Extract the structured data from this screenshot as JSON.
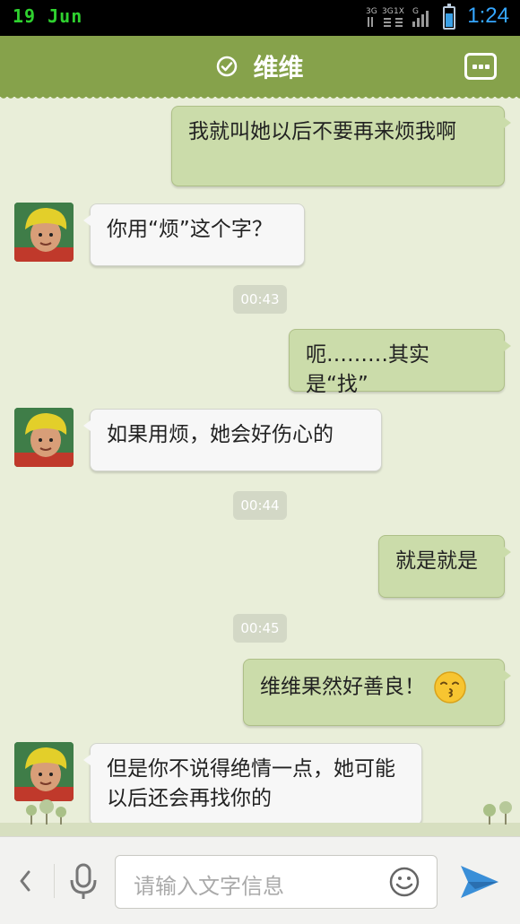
{
  "status_bar": {
    "date": "19 Jun",
    "network_labels": [
      "3G",
      "3G",
      "1X",
      "G"
    ],
    "time": "1:24",
    "battery_level_percent": 70
  },
  "header": {
    "title": "维维",
    "verified_icon": "check-circle-icon",
    "menu_icon": "more-dots-icon"
  },
  "messages": [
    {
      "dir": "out",
      "text": "我就叫她以后不要再来烦我啊"
    },
    {
      "dir": "in",
      "text": "你用“烦”这个字？"
    },
    {
      "type": "time",
      "text": "00:43"
    },
    {
      "dir": "out",
      "text": "呃………其实是“找”"
    },
    {
      "dir": "in",
      "text": "如果用烦，她会好伤心的"
    },
    {
      "type": "time",
      "text": "00:44"
    },
    {
      "dir": "out",
      "text": "就是就是"
    },
    {
      "type": "time",
      "text": "00:45"
    },
    {
      "dir": "out",
      "text": "维维果然好善良！",
      "emoji": "kiss-face-emoji"
    },
    {
      "dir": "in",
      "text": "但是你不说得绝情一点，她可能以后还会再找你的"
    }
  ],
  "input_bar": {
    "placeholder": "请输入文字信息",
    "icons": [
      "chevron-left-icon",
      "microphone-icon",
      "smiley-icon",
      "send-icon"
    ]
  },
  "colors": {
    "header_bg": "#86a24b",
    "chat_bg": "#e9eed9",
    "outgoing_bubble": "#cbdcaa",
    "incoming_bubble": "#f7f7f7",
    "status_time": "#35a6ff",
    "status_date": "#2fd12f"
  }
}
